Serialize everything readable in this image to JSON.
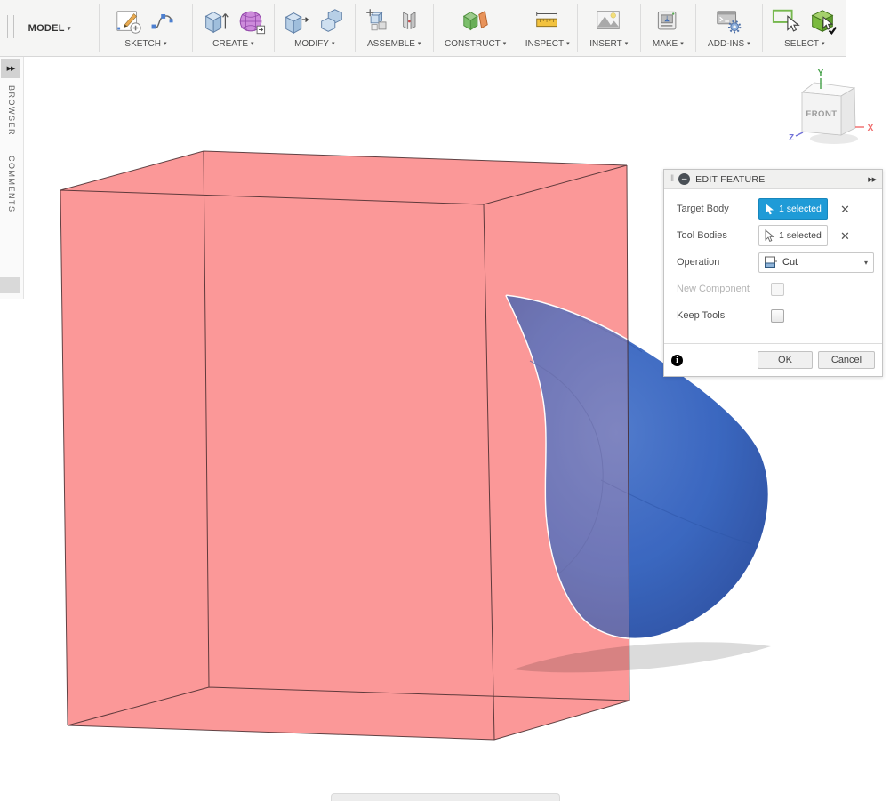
{
  "toolbar": {
    "model_label": "MODEL",
    "caret": "▾",
    "groups": [
      {
        "label": "SKETCH"
      },
      {
        "label": "CREATE"
      },
      {
        "label": "MODIFY"
      },
      {
        "label": "ASSEMBLE"
      },
      {
        "label": "CONSTRUCT"
      },
      {
        "label": "INSPECT"
      },
      {
        "label": "INSERT"
      },
      {
        "label": "MAKE"
      },
      {
        "label": "ADD-INS"
      },
      {
        "label": "SELECT"
      }
    ]
  },
  "sidebar": {
    "expand_icon": "▶▶",
    "browser_label": "BROWSER",
    "comments_label": "COMMENTS"
  },
  "viewcube": {
    "front_label": "FRONT",
    "axis_x": "X",
    "axis_y": "Y",
    "axis_z": "Z"
  },
  "dialog": {
    "title": "EDIT FEATURE",
    "grip_icon": "‖",
    "collapse_icon": "–",
    "expand_icon": "▶▶",
    "close_icon": "✕",
    "info_icon": "i",
    "rows": {
      "target_body": {
        "label": "Target Body",
        "value": "1 selected"
      },
      "tool_bodies": {
        "label": "Tool Bodies",
        "value": "1 selected"
      },
      "operation": {
        "label": "Operation",
        "value": "Cut"
      },
      "new_component": {
        "label": "New Component",
        "checked": false
      },
      "keep_tools": {
        "label": "Keep Tools",
        "checked": false
      }
    },
    "ok_label": "OK",
    "cancel_label": "Cancel"
  },
  "colors": {
    "accent_blue": "#1F9BD7",
    "box_pink": "#FB9898",
    "box_edge": "#44292B",
    "sphere_blue": "#3463BE",
    "sphere_dark": "#2B4FA2",
    "sphere_light": "#4E79CB",
    "axis_x_red": "#EF6A6A",
    "axis_y_green": "#43A047",
    "axis_z_blue": "#7070D8"
  }
}
